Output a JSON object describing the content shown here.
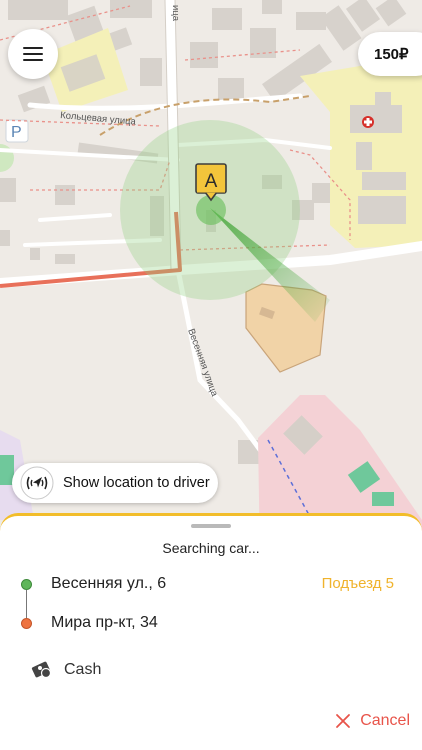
{
  "header": {
    "price": "150₽"
  },
  "map": {
    "pin_label": "A",
    "streets": {
      "ring_street": "Кольцевая улица",
      "spring_street": "Весенняя улица",
      "top_street": "ица"
    },
    "parking_label": "P"
  },
  "controls": {
    "show_location_label": "Show location to driver"
  },
  "sheet": {
    "status": "Searching car...",
    "from": "Весенняя ул., 6",
    "entrance": "Подъезд 5",
    "to": "Мира пр-кт, 34",
    "payment": "Cash",
    "cancel": "Cancel"
  },
  "colors": {
    "accent": "#f2bd2a",
    "cancel": "#e8544a",
    "from_dot": "#5fb65a",
    "to_dot": "#ee7340"
  }
}
